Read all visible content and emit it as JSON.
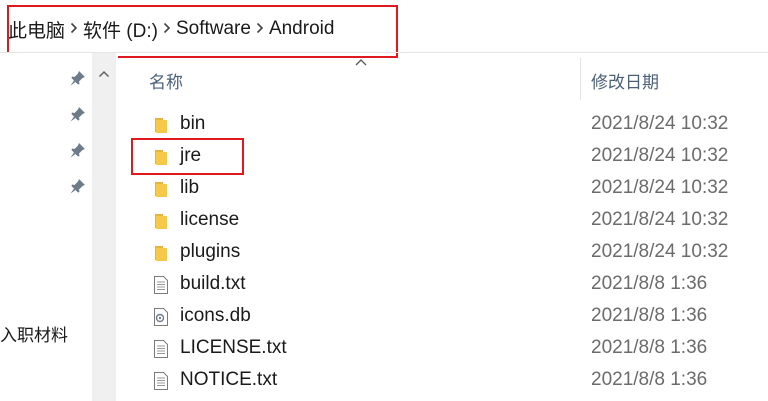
{
  "breadcrumb": {
    "items": [
      "此电脑",
      "软件 (D:)",
      "Software",
      "Android"
    ],
    "separator_icon": "chevron-right-icon"
  },
  "nav": {
    "pinned_icon": "pin-icon",
    "scroll_up_icon": "chevron-up-icon",
    "visible_label": "入职材料"
  },
  "columns": {
    "name": "名称",
    "date_modified": "修改日期",
    "sort_indicator_icon": "sort-ascending-icon"
  },
  "files": [
    {
      "name": "bin",
      "type": "folder",
      "icon": "folder-icon",
      "modified": "2021/8/24 10:32"
    },
    {
      "name": "jre",
      "type": "folder",
      "icon": "folder-icon",
      "modified": "2021/8/24 10:32"
    },
    {
      "name": "lib",
      "type": "folder",
      "icon": "folder-icon",
      "modified": "2021/8/24 10:32"
    },
    {
      "name": "license",
      "type": "folder",
      "icon": "folder-icon",
      "modified": "2021/8/24 10:32"
    },
    {
      "name": "plugins",
      "type": "folder",
      "icon": "folder-icon",
      "modified": "2021/8/24 10:32"
    },
    {
      "name": "build.txt",
      "type": "text",
      "icon": "text-file-icon",
      "modified": "2021/8/8 1:36"
    },
    {
      "name": "icons.db",
      "type": "db",
      "icon": "db-file-icon",
      "modified": "2021/8/8 1:36"
    },
    {
      "name": "LICENSE.txt",
      "type": "text",
      "icon": "text-file-icon",
      "modified": "2021/8/8 1:36"
    },
    {
      "name": "NOTICE.txt",
      "type": "text",
      "icon": "text-file-icon",
      "modified": "2021/8/8 1:36"
    }
  ],
  "annotation_color": "#e0191f",
  "folder_color": "#f7c948"
}
